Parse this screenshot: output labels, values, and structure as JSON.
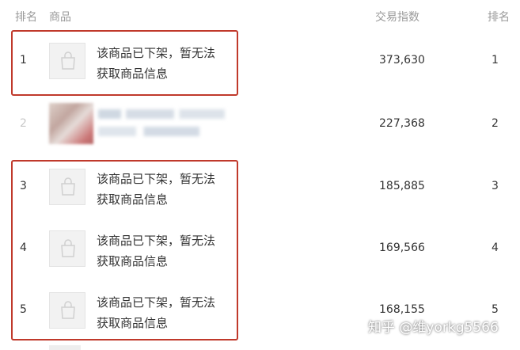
{
  "header": {
    "rank_label": "排名",
    "product_label": "商品",
    "index_label": "交易指数",
    "rank_label_right": "排名"
  },
  "rows": [
    {
      "rank": "1",
      "name_line1": "该商品已下架，暂无法",
      "name_line2": "获取商品信息",
      "index": "373,630",
      "rank_right": "1",
      "thumbnail_icon": "shopping-bag-icon"
    },
    {
      "rank": "2",
      "name_line1": "",
      "name_line2": "",
      "index": "227,368",
      "rank_right": "2",
      "thumbnail_icon": "blurred-product-image"
    },
    {
      "rank": "3",
      "name_line1": "该商品已下架，暂无法",
      "name_line2": "获取商品信息",
      "index": "185,885",
      "rank_right": "3",
      "thumbnail_icon": "shopping-bag-icon"
    },
    {
      "rank": "4",
      "name_line1": "该商品已下架，暂无法",
      "name_line2": "获取商品信息",
      "index": "169,566",
      "rank_right": "4",
      "thumbnail_icon": "shopping-bag-icon"
    },
    {
      "rank": "5",
      "name_line1": "该商品已下架，暂无法",
      "name_line2": "获取商品信息",
      "index": "168,155",
      "rank_right": "5",
      "thumbnail_icon": "shopping-bag-icon"
    }
  ],
  "watermark": "知乎 @维yorkg5566",
  "colors": {
    "highlight_box": "#c0392b",
    "header_text": "#9a9a9a",
    "body_text": "#333333"
  }
}
